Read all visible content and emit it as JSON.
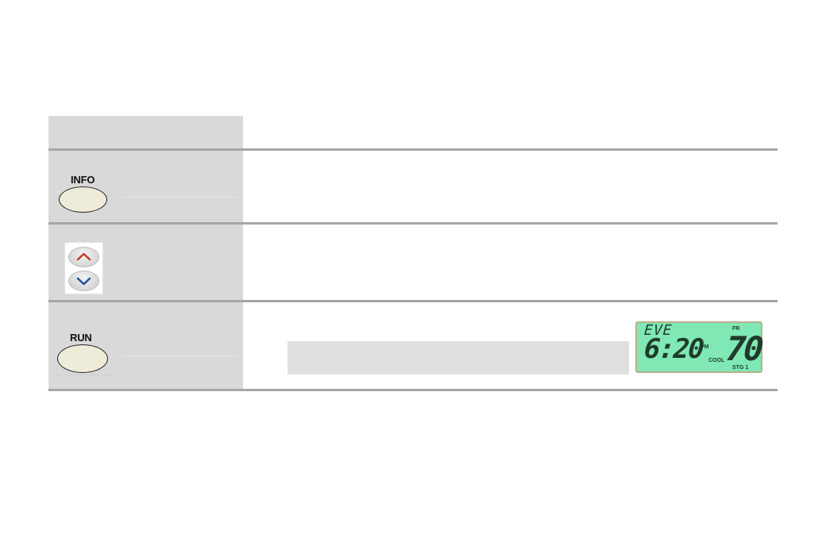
{
  "rows": [
    {
      "button_label": "INFO",
      "icon": "oval-button"
    },
    {
      "button_label": "",
      "icon": "up-down-arrow-buttons"
    },
    {
      "button_label": "RUN",
      "icon": "oval-button"
    }
  ],
  "lcd": {
    "period": "EVE",
    "time": "6:20",
    "ampm": "PM",
    "mode": "COOL",
    "day": "FR",
    "temperature": "70",
    "stage": "STG 1"
  },
  "colors": {
    "left_column": "#d9d9d9",
    "rule": "#a6a6a6",
    "lcd_background": "#7fe8b4",
    "button_face": "#eeecd9",
    "up_arrow": "#c0392b",
    "down_arrow": "#1f4e9e"
  }
}
